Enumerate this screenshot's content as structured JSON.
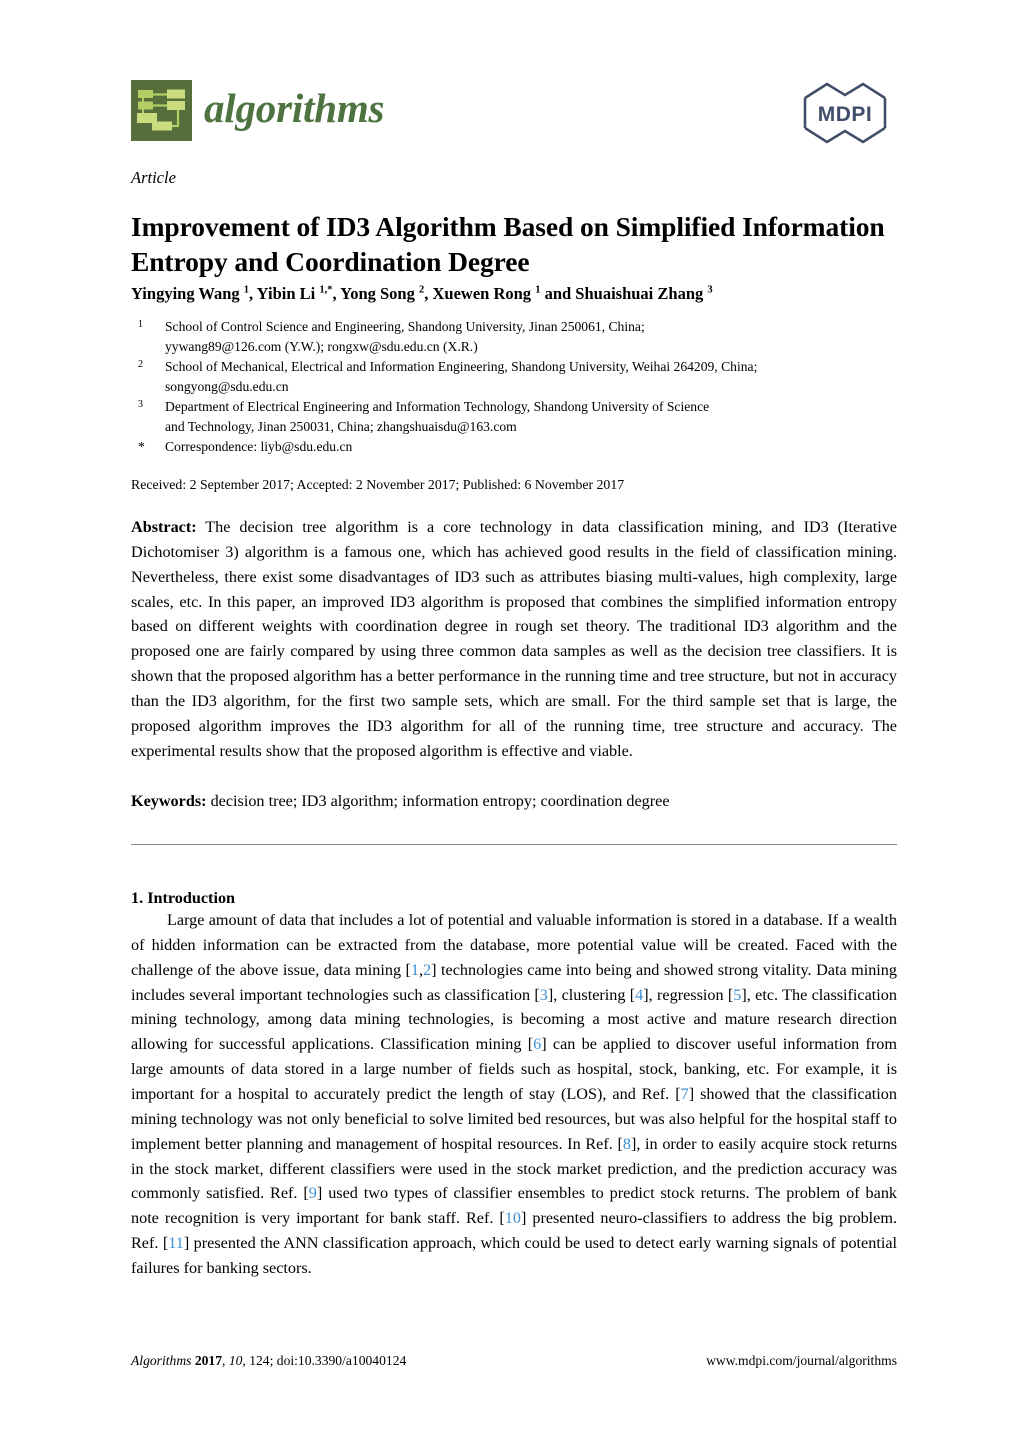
{
  "masthead": {
    "journal_name": "algorithms",
    "journal_logo_icon": "algorithms-flowchart-logo-icon",
    "publisher_name": "MDPI",
    "publisher_logo_icon": "mdpi-hexagon-logo-icon",
    "logo_bg_color": "#566E3C",
    "logo_node_color": "#B5CE63",
    "wordmark_color": "#4C7340",
    "publisher_logo_color": "#414E6B"
  },
  "article": {
    "type_label": "Article",
    "title": "Improvement of ID3 Algorithm Based on Simplified Information Entropy and Coordination Degree",
    "authors_html": "Yingying Wang <sup>1</sup>, Yibin Li <sup>1,*</sup>, Yong Song <sup>2</sup>, Xuewen Rong <sup>1</sup> and Shuaishuai Zhang <sup>3</sup>",
    "affiliations": [
      {
        "marker": "1",
        "lines": [
          "School of Control Science and Engineering, Shandong University, Jinan 250061, China;",
          "yywang89@126.com (Y.W.); rongxw@sdu.edu.cn (X.R.)"
        ]
      },
      {
        "marker": "2",
        "lines": [
          "School of Mechanical, Electrical and Information Engineering, Shandong University, Weihai 264209, China;",
          "songyong@sdu.edu.cn"
        ]
      },
      {
        "marker": "3",
        "lines": [
          "Department of Electrical Engineering and Information Technology, Shandong University of Science",
          "and Technology, Jinan 250031, China; zhangshuaisdu@163.com"
        ]
      },
      {
        "marker": "*",
        "lines": [
          "Correspondence: liyb@sdu.edu.cn"
        ]
      }
    ],
    "publication_dates": "Received: 2 September 2017; Accepted: 2 November 2017; Published: 6 November 2017",
    "abstract_label": "Abstract:",
    "abstract_text": "The decision tree algorithm is a core technology in data classification mining, and ID3 (Iterative Dichotomiser 3) algorithm is a famous one, which has achieved good results in the field of classification mining. Nevertheless, there exist some disadvantages of ID3 such as attributes biasing multi-values, high complexity, large scales, etc. In this paper, an improved ID3 algorithm is proposed that combines the simplified information entropy based on different weights with coordination degree in rough set theory. The traditional ID3 algorithm and the proposed one are fairly compared by using three common data samples as well as the decision tree classifiers. It is shown that the proposed algorithm has a better performance in the running time and tree structure, but not in accuracy than the ID3 algorithm, for the first two sample sets, which are small. For the third sample set that is large, the proposed algorithm improves the ID3 algorithm for all of the running time, tree structure and accuracy. The experimental results show that the proposed algorithm is effective and viable.",
    "keywords_label": "Keywords:",
    "keywords_text": "decision tree; ID3 algorithm; information entropy; coordination degree"
  },
  "body": {
    "section_heading": "1. Introduction",
    "paragraph_html": "Large amount of data that includes a lot of potential and valuable information is stored in a database. If a wealth of hidden information can be extracted from the database, more potential value will be created. Faced with the challenge of the above issue, data mining [<span class=\"cite\">1</span>,<span class=\"cite\">2</span>] technologies came into being and showed strong vitality. Data mining includes several important technologies such as classification [<span class=\"cite\">3</span>], clustering [<span class=\"cite\">4</span>], regression [<span class=\"cite\">5</span>], etc. The classification mining technology, among data mining technologies, is becoming a most active and mature research direction allowing for successful applications. Classification mining [<span class=\"cite\">6</span>] can be applied to discover useful information from large amounts of data stored in a large number of fields such as hospital, stock, banking, etc. For example, it is important for a hospital to accurately predict the length of stay (LOS), and Ref. [<span class=\"cite\">7</span>] showed that the classification mining technology was not only beneficial to solve limited bed resources, but was also helpful for the hospital staff to implement better planning and management of hospital resources. In Ref. [<span class=\"cite\">8</span>], in order to easily acquire stock returns in the stock market, different classifiers were used in the stock market prediction, and the prediction accuracy was commonly satisfied. Ref. [<span class=\"cite\">9</span>] used two types of classifier ensembles to predict stock returns. The problem of bank note recognition is very important for bank staff. Ref. [<span class=\"cite\">10</span>] presented neuro-classifiers to address the big problem. Ref. [<span class=\"cite\">11</span>] presented the ANN classification approach, which could be used to detect early warning signals of potential failures for banking sectors.",
    "citation_color": "#3C8FD4"
  },
  "footer": {
    "left_html": "<i>Algorithms</i> <b>2017</b>, <i>10</i>, 124; doi:10.3390/a10040124",
    "right_text": "www.mdpi.com/journal/algorithms"
  }
}
